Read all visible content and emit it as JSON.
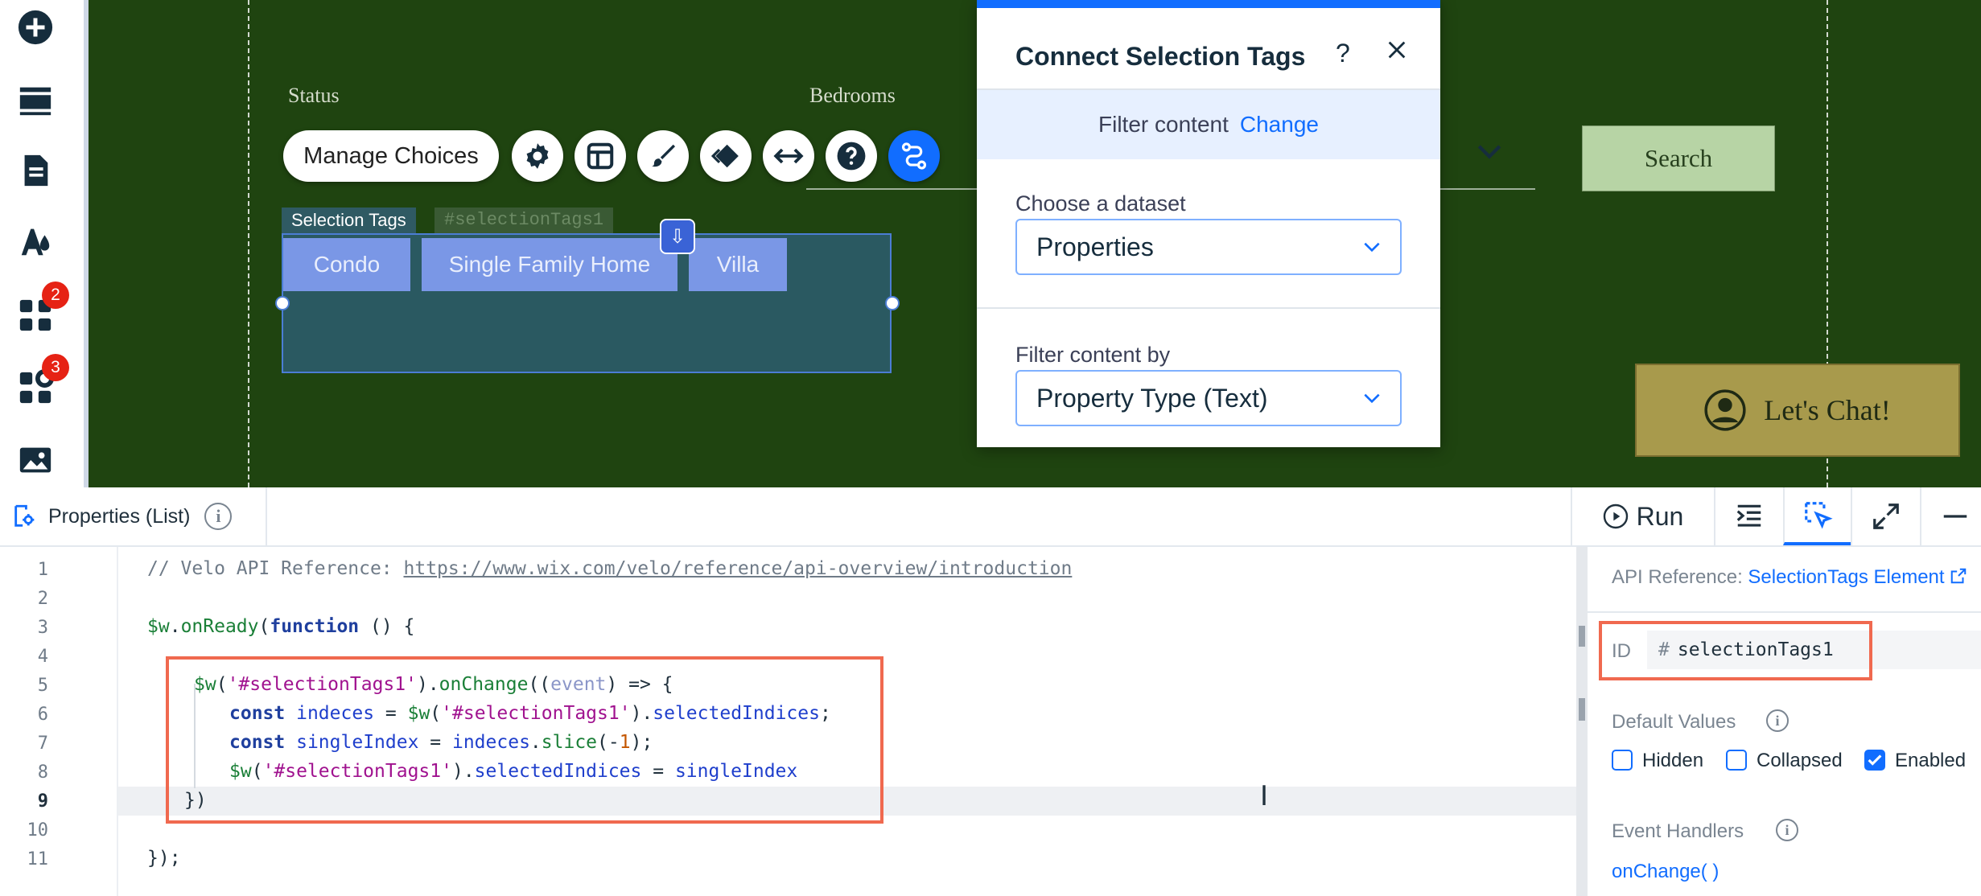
{
  "rail": {
    "items": [
      {
        "icon": "add-icon"
      },
      {
        "icon": "sections-icon"
      },
      {
        "icon": "pages-icon"
      },
      {
        "icon": "theme-icon"
      },
      {
        "icon": "apps-icon",
        "badge": "2"
      },
      {
        "icon": "business-tools-icon",
        "badge": "3"
      },
      {
        "icon": "media-icon"
      }
    ]
  },
  "canvas": {
    "status_label": "Status",
    "bedrooms_label": "Bedrooms",
    "search_label": "Search",
    "chat_label": "Let's Chat!",
    "selection_tags_label": "Selection Tags",
    "selection_tags_id": "#selectionTags1",
    "tags": [
      "Condo",
      "Single Family Home",
      "Villa"
    ],
    "manage_choices": "Manage Choices"
  },
  "connect_panel": {
    "title": "Connect Selection Tags",
    "help": "?",
    "filter_content": "Filter content",
    "change": "Change",
    "choose_dataset_label": "Choose a dataset",
    "dataset_value": "Properties",
    "filter_by_label": "Filter content by",
    "filter_by_value": "Property Type (Text)"
  },
  "code_panel": {
    "file_name": "Properties (List)",
    "run_label": "Run",
    "line_numbers": [
      "1",
      "2",
      "3",
      "4",
      "5",
      "6",
      "7",
      "8",
      "9",
      "10",
      "11"
    ],
    "current_line": "9"
  },
  "props_panel": {
    "api_ref_label": "API Reference:",
    "api_ref_link": "SelectionTags Element",
    "id_label": "ID",
    "id_hash": "#",
    "id_value": "selectionTags1",
    "default_values_label": "Default Values",
    "hidden": "Hidden",
    "collapsed": "Collapsed",
    "enabled": "Enabled",
    "enabled_checked": true,
    "event_handlers_label": "Event Handlers",
    "on_change": "onChange( )"
  },
  "colors": {
    "accent": "#116dff",
    "canvas_bg": "#1f4410",
    "highlight_box": "#f0694f"
  }
}
